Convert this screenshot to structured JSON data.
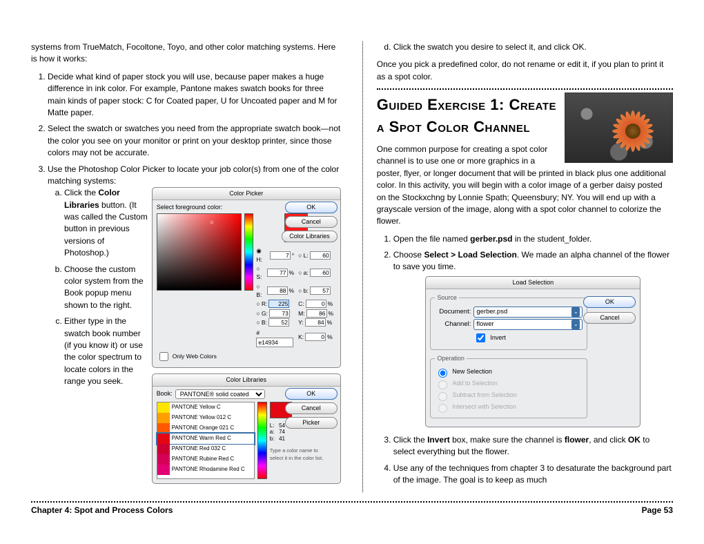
{
  "left": {
    "intro": "systems from TrueMatch, Focoltone, Toyo, and other color matching systems. Here is how it works:",
    "steps": [
      "Decide what kind of paper stock you will use, because paper makes a huge difference in ink color. For example, Pantone makes swatch books for three main kinds of paper stock: C for Coated paper, U for Uncoated paper and M for Matte paper.",
      "Select the swatch or swatches you need from the appropriate swatch book—not the color you see on your monitor or print on your desktop printer, since those colors may not be accurate.",
      "Use the Photoshop Color Picker to locate your job color(s) from one of the color matching systems:"
    ],
    "sub": {
      "a1": "Click the ",
      "a2": "Color Libraries",
      "a3": " button. (It was called the Custom button in previous versions of Photoshop.)",
      "b": "Choose the custom color system from the Book popup menu shown to the right.",
      "c": "Either type in the swatch book number (if you know it) or use the color spectrum to locate colors in the range you seek."
    }
  },
  "picker": {
    "title": "Color Picker",
    "prompt": "Select foreground color:",
    "ok": "OK",
    "cancel": "Cancel",
    "lib": "Color Libraries",
    "H": "7",
    "S": "77",
    "B": "88",
    "L": "60",
    "a": "60",
    "b2": "57",
    "R": "225",
    "G": "73",
    "Bv": "52",
    "C": "0",
    "M": "86",
    "Y": "84",
    "K": "0",
    "hex": "e14934",
    "only": "Only Web Colors"
  },
  "clib": {
    "title": "Color Libraries",
    "booklbl": "Book:",
    "book": "PANTONE® solid coated",
    "ok": "OK",
    "cancel": "Cancel",
    "picker": "Picker",
    "L": "54",
    "a": "74",
    "b": "41",
    "note": "Type a color name to select it in the color list.",
    "rows": [
      {
        "c": "#ffe400",
        "n": "PANTONE Yellow C"
      },
      {
        "c": "#ff9e00",
        "n": "PANTONE Yellow 012 C"
      },
      {
        "c": "#ff5800",
        "n": "PANTONE Orange 021 C"
      },
      {
        "c": "#e30613",
        "n": "PANTONE Warm Red C"
      },
      {
        "c": "#cc0033",
        "n": "PANTONE Red 032 C"
      },
      {
        "c": "#d60057",
        "n": "PANTONE Rubine Red C"
      },
      {
        "c": "#e20074",
        "n": "PANTONE Rhodamine Red C"
      }
    ]
  },
  "right": {
    "d": "Click the swatch you desire to select it, and click OK.",
    "after": "Once you pick a predefined color, do not rename or edit it, if you plan to print it as a spot color.",
    "h2": "Guided Exercise 1: Create a Spot Color Channel",
    "para": "One common purpose for creating a spot color channel is to use one or more graphics in a poster, flyer, or longer document that will be printed in black plus one additional color. In this activity, you will begin with a color image of a gerber daisy posted on the Stockxchng by Lonnie Spath; Queensbury; NY. You will end up with a grayscale version of the image, along with a spot color channel to colorize the flower.",
    "step1a": "Open the file named ",
    "step1b": "gerber.psd",
    "step1c": " in the student_folder.",
    "step2a": "Choose ",
    "step2b": "Select > Load Selection",
    "step2c": ". We made an alpha channel of the flower to save you time.",
    "step3a": "Click the ",
    "step3b": "Invert",
    "step3c": " box, make sure the channel is ",
    "step3d": "flower",
    "step3e": ", and click ",
    "step3f": "OK",
    "step3g": " to select everything but the flower.",
    "step4": "Use any of the techniques from chapter 3 to desaturate the background part of the image. The goal is to keep as much"
  },
  "load": {
    "title": "Load Selection",
    "src": "Source",
    "doclbl": "Document:",
    "doc": "gerber.psd",
    "chlbl": "Channel:",
    "ch": "flower",
    "inv": "Invert",
    "op": "Operation",
    "r1": "New Selection",
    "r2": "Add to Selection",
    "r3": "Subtract from Selection",
    "r4": "Intersect with Selection",
    "ok": "OK",
    "cancel": "Cancel"
  },
  "footer": {
    "chapter": "Chapter 4: Spot and Process Colors",
    "page": "Page 53"
  }
}
